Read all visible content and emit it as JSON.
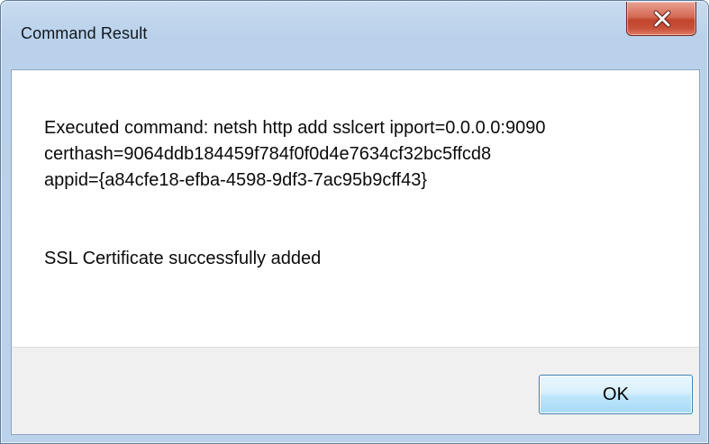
{
  "window": {
    "title": "Command Result"
  },
  "message": {
    "lines": [
      "Executed command: netsh http add sslcert ipport=0.0.0.0:9090",
      "certhash=9064ddb184459f784f0f0d4e7634cf32bc5ffcd8",
      "appid={a84cfe18-efba-4598-9df3-7ac95b9cff43}"
    ],
    "status": "SSL Certificate successfully added"
  },
  "buttons": {
    "ok_label": "OK",
    "close_icon": "close-x-icon"
  },
  "colors": {
    "close_button": "#c7472f",
    "title_bar": "#b9d1ea",
    "footer": "#f0f0f0",
    "ok_button_border": "#3c7fb1"
  }
}
